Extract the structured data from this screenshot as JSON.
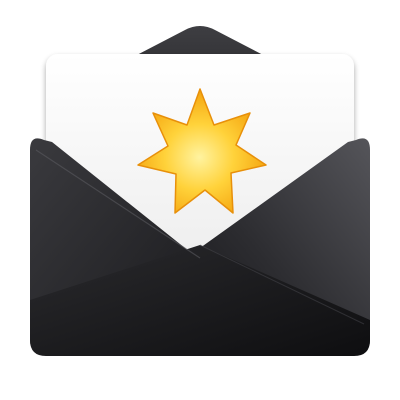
{
  "icon": {
    "name": "mail-envelope-star-icon",
    "colors": {
      "envelope_dark": "#1a1a1c",
      "envelope_mid": "#2e2e31",
      "envelope_light": "#49494d",
      "letter_white": "#fbfbfb",
      "letter_shadow": "#dcdcdc",
      "star_outer": "#f4a60a",
      "star_inner": "#ffe070",
      "star_core": "#fff2a8"
    }
  }
}
